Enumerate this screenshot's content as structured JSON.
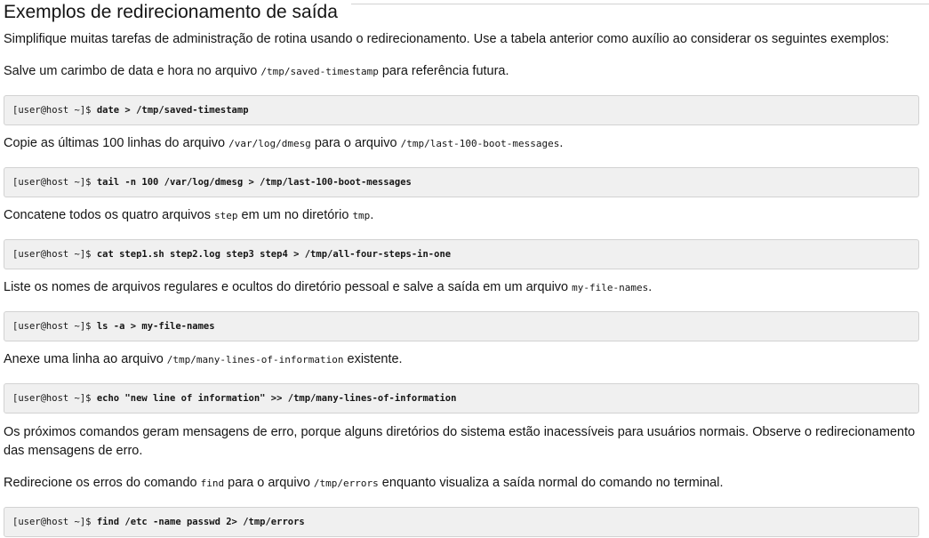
{
  "title": "Exemplos de redirecionamento de saída",
  "intro": "Simplifique muitas tarefas de administração de rotina usando o redirecionamento. Use a tabela anterior como auxílio ao considerar os seguintes exemplos:",
  "prompt": "[user@host ~]$ ",
  "ex1": {
    "before": "Salve um carimbo de data e hora no arquivo ",
    "code": "/tmp/saved-timestamp",
    "after": " para referência futura.",
    "command": "date > /tmp/saved-timestamp"
  },
  "ex2": {
    "before": "Copie as últimas 100 linhas do arquivo ",
    "code1": "/var/log/dmesg",
    "middle": " para o arquivo ",
    "code2": "/tmp/last-100-boot-messages",
    "after": ".",
    "command": "tail -n 100 /var/log/dmesg > /tmp/last-100-boot-messages"
  },
  "ex3": {
    "before": "Concatene todos os quatro arquivos ",
    "code1": "step",
    "middle": " em um no diretório ",
    "code2": "tmp",
    "after": ".",
    "command": "cat step1.sh step2.log step3 step4 > /tmp/all-four-steps-in-one"
  },
  "ex4": {
    "before": "Liste os nomes de arquivos regulares e ocultos do diretório pessoal e salve a saída em um arquivo ",
    "code": "my-file-names",
    "after": ".",
    "command": "ls -a > my-file-names"
  },
  "ex5": {
    "before": "Anexe uma linha ao arquivo ",
    "code": "/tmp/many-lines-of-information",
    "after": " existente.",
    "command": "echo \"new line of information\" >> /tmp/many-lines-of-information"
  },
  "errors_intro": "Os próximos comandos geram mensagens de erro, porque alguns diretórios do sistema estão inacessíveis para usuários normais. Observe o redirecionamento das mensagens de erro.",
  "ex6": {
    "before": "Redirecione os erros do comando ",
    "code1": "find",
    "middle": " para o arquivo ",
    "code2": "/tmp/errors",
    "after": " enquanto visualiza a saída normal do comando no terminal.",
    "command": "find /etc -name passwd 2> /tmp/errors"
  }
}
